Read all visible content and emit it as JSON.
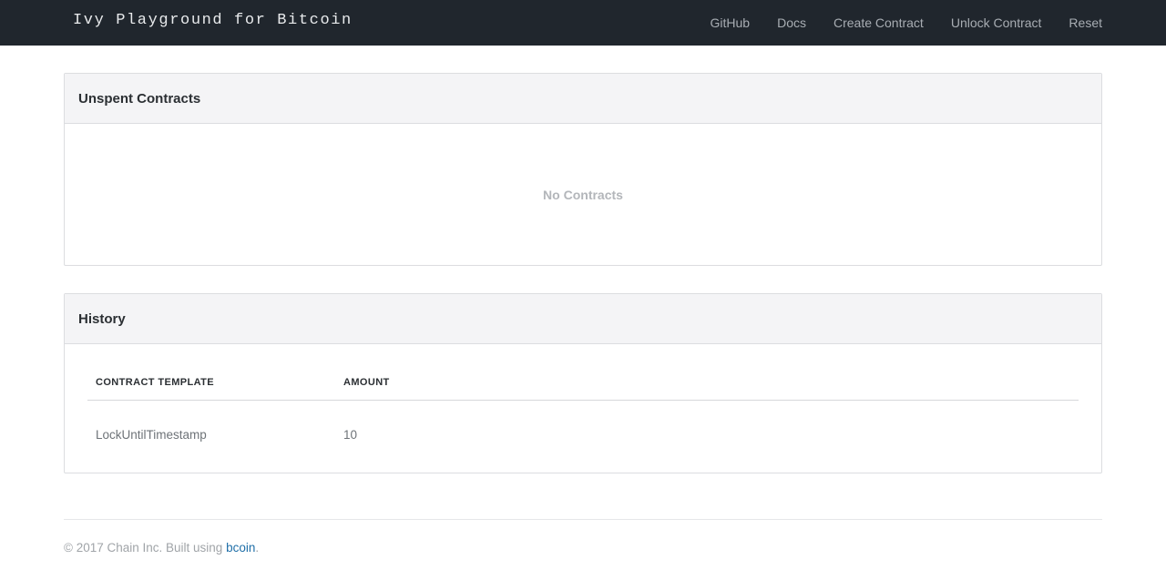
{
  "navbar": {
    "brand": "Ivy Playground for Bitcoin",
    "links": [
      {
        "label": "GitHub"
      },
      {
        "label": "Docs"
      },
      {
        "label": "Create Contract"
      },
      {
        "label": "Unlock Contract"
      },
      {
        "label": "Reset"
      }
    ]
  },
  "unspent": {
    "title": "Unspent Contracts",
    "empty_text": "No Contracts"
  },
  "history": {
    "title": "History",
    "columns": [
      "CONTRACT TEMPLATE",
      "AMOUNT"
    ],
    "rows": [
      {
        "template": "LockUntilTimestamp",
        "amount": "10"
      }
    ]
  },
  "footer": {
    "prefix": "© 2017 Chain Inc. Built using ",
    "link_text": "bcoin",
    "suffix": "."
  },
  "colors": {
    "navbar_bg": "#20262d",
    "link_accent": "#1f6fa8",
    "panel_heading_bg": "#f4f4f6"
  }
}
